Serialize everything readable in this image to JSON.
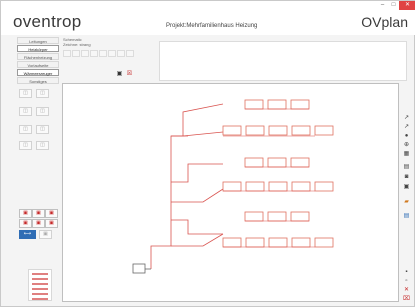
{
  "app": {
    "brand": "oventrop",
    "project_title": "Projekt:Mehrfamilienhaus Heizung",
    "product": "OVplan",
    "window_buttons": {
      "minimize": "–",
      "maximize": "□",
      "close": "✕"
    }
  },
  "left_tabs": [
    {
      "label": "Leitungen",
      "active": false
    },
    {
      "label": "Heizkörper",
      "active": true
    },
    {
      "label": "Flächenheizung",
      "active": false
    },
    {
      "label": "Vorlaufseite",
      "active": false
    },
    {
      "label": "Wärmeerzeuger",
      "active": true
    },
    {
      "label": "Sonstiges",
      "active": false
    }
  ],
  "ribbon": {
    "title": "Schematic",
    "subtitle": "Zeichne: strang"
  },
  "icons": {
    "save": "floppy-icon",
    "delete": "delete-icon",
    "accent_red": "#c62828",
    "pipe_color": "#d9534f",
    "radiator_color": "#e07060"
  }
}
